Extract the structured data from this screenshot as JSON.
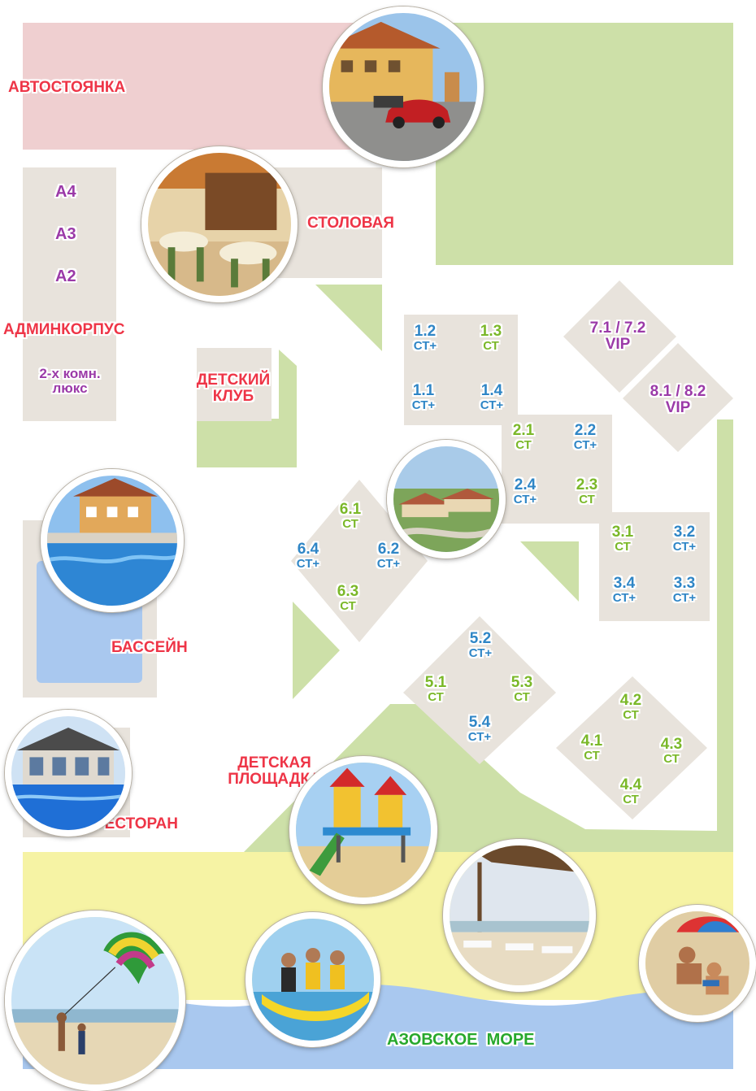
{
  "zones": {
    "parking": "АВТОСТОЯНКА",
    "canteen": "СТОЛОВАЯ",
    "admin": "АДМИНКОРПУС",
    "admin_units": [
      "А4",
      "А3",
      "А2"
    ],
    "suite": "2-х комн.\nлюкс",
    "kids_club": "ДЕТСКИЙ\nКЛУБ",
    "pool": "БАССЕЙН",
    "restaurant": "РЕСТОРАН",
    "playground": "ДЕТСКАЯ\nПЛОЩАДКА",
    "sea": "АЗОВСКОЕ  МОРЕ"
  },
  "units": [
    {
      "num": "1.2",
      "type": "СТ+",
      "color": "#2f86c6"
    },
    {
      "num": "1.3",
      "type": "СТ",
      "color": "#7bb829"
    },
    {
      "num": "1.1",
      "type": "СТ+",
      "color": "#2f86c6"
    },
    {
      "num": "1.4",
      "type": "СТ+",
      "color": "#2f86c6"
    },
    {
      "num": "2.1",
      "type": "СТ",
      "color": "#7bb829"
    },
    {
      "num": "2.2",
      "type": "СТ+",
      "color": "#2f86c6"
    },
    {
      "num": "2.4",
      "type": "СТ+",
      "color": "#2f86c6"
    },
    {
      "num": "2.3",
      "type": "СТ",
      "color": "#7bb829"
    },
    {
      "num": "3.1",
      "type": "СТ",
      "color": "#7bb829"
    },
    {
      "num": "3.2",
      "type": "СТ+",
      "color": "#2f86c6"
    },
    {
      "num": "3.4",
      "type": "СТ+",
      "color": "#2f86c6"
    },
    {
      "num": "3.3",
      "type": "СТ+",
      "color": "#2f86c6"
    },
    {
      "num": "4.2",
      "type": "СТ",
      "color": "#7bb829"
    },
    {
      "num": "4.1",
      "type": "СТ",
      "color": "#7bb829"
    },
    {
      "num": "4.3",
      "type": "СТ",
      "color": "#7bb829"
    },
    {
      "num": "4.4",
      "type": "СТ",
      "color": "#7bb829"
    },
    {
      "num": "5.2",
      "type": "СТ+",
      "color": "#2f86c6"
    },
    {
      "num": "5.1",
      "type": "СТ",
      "color": "#7bb829"
    },
    {
      "num": "5.3",
      "type": "СТ",
      "color": "#7bb829"
    },
    {
      "num": "5.4",
      "type": "СТ+",
      "color": "#2f86c6"
    },
    {
      "num": "6.1",
      "type": "СТ",
      "color": "#7bb829"
    },
    {
      "num": "6.4",
      "type": "СТ+",
      "color": "#2f86c6"
    },
    {
      "num": "6.2",
      "type": "СТ+",
      "color": "#2f86c6"
    },
    {
      "num": "6.3",
      "type": "СТ",
      "color": "#7bb829"
    },
    {
      "num": "7.1 / 7.2",
      "type": "VIP",
      "color": "#9b3aa8"
    },
    {
      "num": "8.1 / 8.2",
      "type": "VIP",
      "color": "#9b3aa8"
    }
  ],
  "colors": {
    "building": "#e8e3dc",
    "lawn": "#cde0a8",
    "parking": "#efcfd0",
    "beach": "#f6f3a4",
    "sea": "#a9c8ef",
    "label_red": "#ee3547",
    "label_purple": "#9b3aa8",
    "type_st_plus": "#2f86c6",
    "type_st": "#7bb829"
  },
  "photos": [
    {
      "name": "parking-photo-icon"
    },
    {
      "name": "canteen-photo-icon"
    },
    {
      "name": "resort-overview-photo-icon"
    },
    {
      "name": "pool-photo-icon"
    },
    {
      "name": "restaurant-photo-icon"
    },
    {
      "name": "playground-photo-icon"
    },
    {
      "name": "beach-canopy-photo-icon"
    },
    {
      "name": "parasailing-photo-icon"
    },
    {
      "name": "banana-boat-photo-icon"
    },
    {
      "name": "sunbathers-photo-icon"
    }
  ]
}
